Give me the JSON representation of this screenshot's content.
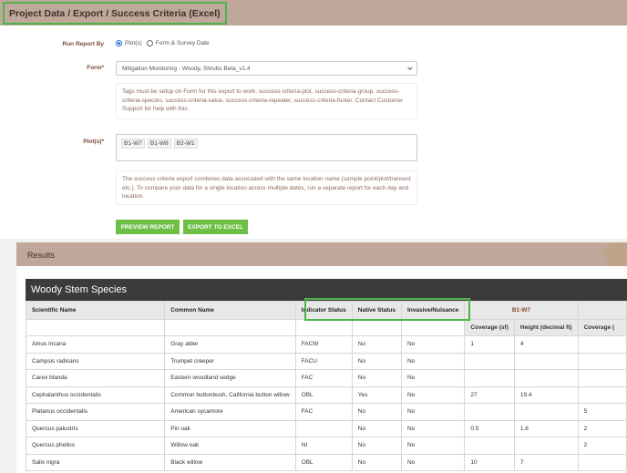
{
  "breadcrumb": "Project Data / Export / Success Criteria (Excel)",
  "form": {
    "run_report_by": {
      "label": "Run Report By",
      "options": [
        "Plot(s)",
        "Form & Survey Date"
      ],
      "selected": "Plot(s)"
    },
    "form_field": {
      "label": "Form*",
      "value": "Mitigation Monitoring - Woody, Shrubs Beta_v1.4"
    },
    "tags_note": "Tags must be setup on Form for this export to work: success-criteria-plot, success-criteria-group, success-criteria-species, success-criteria-value, success-criteria-repeater, success-criteria-footer. Contact Customer Support for help with this.",
    "plots_field": {
      "label": "Plot(s)*",
      "tags": [
        "B1-W7",
        "B1-W8",
        "B2-W1"
      ]
    },
    "combine_note": "The success criteria export combines data associated with the same location name (sample point/plot/transect etc.). To compare your data for a single location across multiple dates, run a separate report for each day and location.",
    "buttons": {
      "preview": "PREVIEW REPORT",
      "export": "EXPORT TO EXCEL"
    }
  },
  "results": {
    "title": "Results",
    "table_title": "Woody Stem Species",
    "columns": [
      "Scientific Name",
      "Common Name",
      "Indicator Status",
      "Native Status",
      "Invasive/Nuisance"
    ],
    "plot_group": "B1-W7",
    "subcolumns": [
      "Coverage (sf)",
      "Height (decimal ft)",
      "Coverage ("
    ],
    "rows": [
      {
        "scientific": "Alnus incana",
        "common": "Gray alder",
        "indicator": "FACW",
        "native": "No",
        "invasive": "No",
        "cov": "1",
        "height": "4",
        "cov2": ""
      },
      {
        "scientific": "Campsis radicans",
        "common": "Trumpet creeper",
        "indicator": "FACU",
        "native": "No",
        "invasive": "No",
        "cov": "",
        "height": "",
        "cov2": ""
      },
      {
        "scientific": "Carex blanda",
        "common": "Eastern woodland sedge",
        "indicator": "FAC",
        "native": "No",
        "invasive": "No",
        "cov": "",
        "height": "",
        "cov2": ""
      },
      {
        "scientific": "Cephalanthus occidentalis",
        "common": "Common buttonbush, California button willow",
        "indicator": "OBL",
        "native": "Yes",
        "invasive": "No",
        "cov": "27",
        "height": "19.4",
        "cov2": ""
      },
      {
        "scientific": "Platanus occidentalis",
        "common": "American sycamore",
        "indicator": "FAC",
        "native": "No",
        "invasive": "No",
        "cov": "",
        "height": "",
        "cov2": "5"
      },
      {
        "scientific": "Quercus palustris",
        "common": "Pin oak",
        "indicator": "",
        "native": "No",
        "invasive": "No",
        "cov": "0.5",
        "height": "1.6",
        "cov2": "2"
      },
      {
        "scientific": "Quercus phellos",
        "common": "Willow oak",
        "indicator": "NI",
        "native": "No",
        "invasive": "No",
        "cov": "",
        "height": "",
        "cov2": "2"
      },
      {
        "scientific": "Salix nigra",
        "common": "Black willow",
        "indicator": "OBL",
        "native": "No",
        "invasive": "No",
        "cov": "10",
        "height": "7",
        "cov2": ""
      }
    ]
  }
}
